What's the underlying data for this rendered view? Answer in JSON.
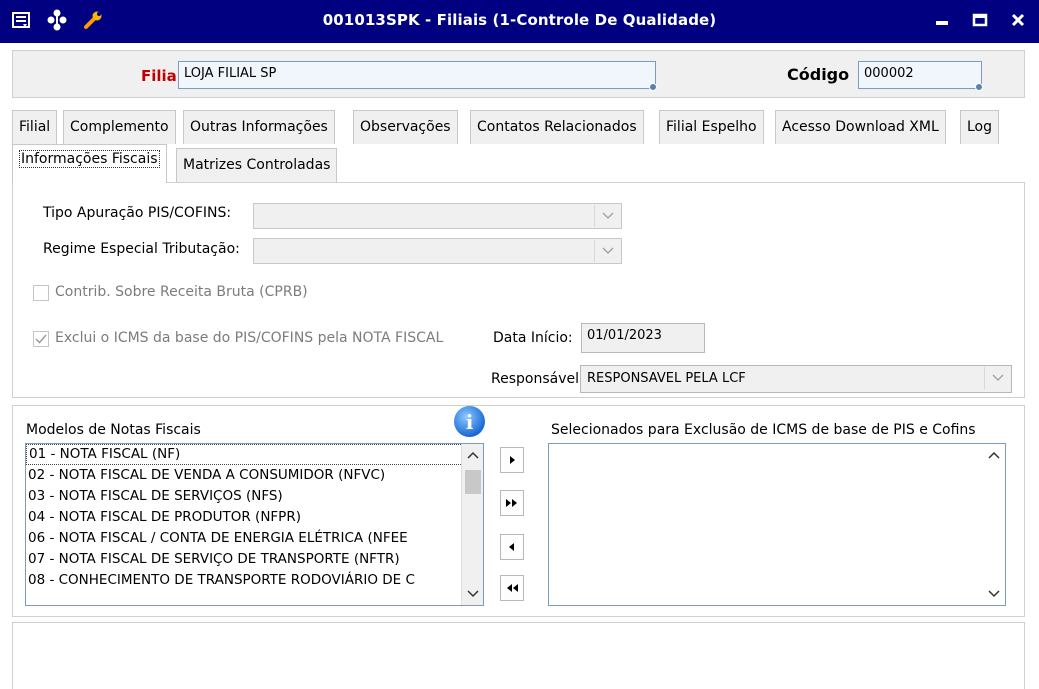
{
  "window": {
    "title": "001013SPK - Filiais (1-Controle De Qualidade)",
    "icons": [
      "menu-icon",
      "tree-icon",
      "wrench-icon"
    ],
    "controls": [
      "minimize-icon",
      "maximize-icon",
      "close-icon"
    ]
  },
  "header": {
    "filial_label": "Filial",
    "filial_value": "LOJA FILIAL SP",
    "codigo_label": "Código",
    "codigo_value": "000002"
  },
  "tabs_row1": [
    "Filial",
    "Complemento",
    "Outras Informações",
    "Observações",
    "Contatos Relacionados",
    "Filial Espelho",
    "Acesso Download XML",
    "Log"
  ],
  "tabs_row2": [
    "Informações Fiscais",
    "Matrizes Controladas"
  ],
  "active_tab": "Informações Fiscais",
  "fiscal": {
    "tipo_apuracao_label": "Tipo Apuração PIS/COFINS:",
    "tipo_apuracao_value": "",
    "regime_label": "Regime Especial Tributação:",
    "regime_value": "",
    "cprb_label": "Contrib. Sobre Receita Bruta (CPRB)",
    "cprb_checked": false,
    "exclui_label": "Exclui o ICMS da base do PIS/COFINS pela NOTA FISCAL",
    "exclui_checked": true,
    "data_inicio_label": "Data Início:",
    "data_inicio_value": "01/01/2023",
    "responsavel_label": "Responsável:",
    "responsavel_value": "RESPONSAVEL PELA LCF"
  },
  "models": {
    "left_title": "Modelos de Notas Fiscais",
    "right_title": "Selecionados para Exclusão de ICMS de base de PIS e Cofins",
    "items": [
      "01  - NOTA FISCAL (NF)",
      "02  - NOTA FISCAL DE VENDA A CONSUMIDOR (NFVC)",
      "03  - NOTA FISCAL DE SERVIÇOS (NFS)",
      "04  - NOTA FISCAL DE PRODUTOR (NFPR)",
      "06  - NOTA FISCAL / CONTA DE ENERGIA ELÉTRICA (NFEE",
      "07  - NOTA FISCAL DE SERVIÇO DE TRANSPORTE (NFTR)",
      "08  - CONHECIMENTO DE TRANSPORTE RODOVIÁRIO DE C"
    ],
    "selected": []
  },
  "colors": {
    "titlebar": "#000080",
    "filial_label": "#c00000",
    "field_border": "#7a9cbe"
  }
}
